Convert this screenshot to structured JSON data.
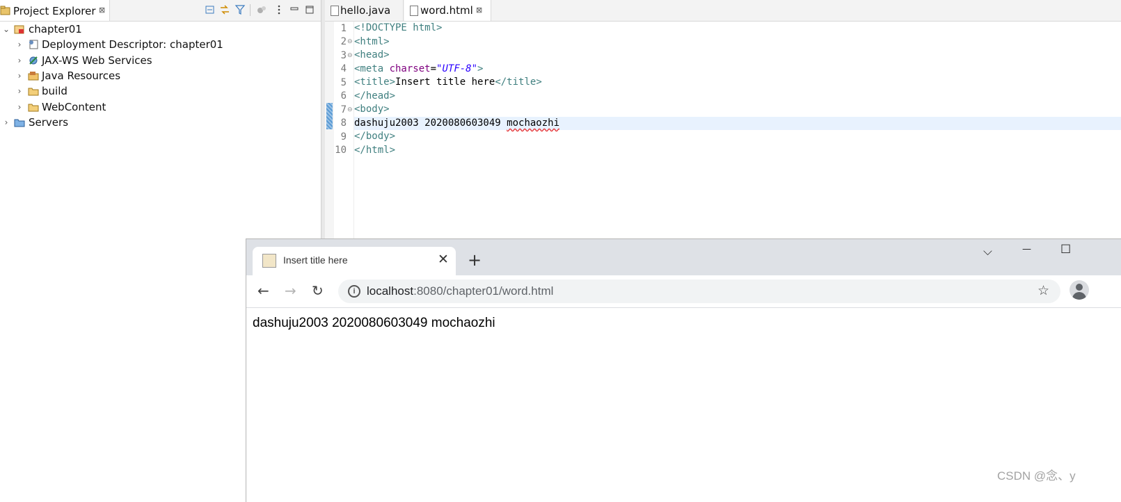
{
  "project_explorer": {
    "title": "Project Explorer",
    "tab_close": "⊠",
    "toolbar_icons": [
      "collapse-all-icon",
      "link-with-editor-icon",
      "filter-icon",
      "focus-icon",
      "view-menu-icon",
      "minimize-icon",
      "maximize-icon"
    ],
    "tree": [
      {
        "label": "chapter01",
        "chevron": "⌄",
        "icon": "web-project-icon"
      },
      {
        "label": "Deployment Descriptor: chapter01",
        "chevron": "›",
        "icon": "deployment-descriptor-icon"
      },
      {
        "label": "JAX-WS Web Services",
        "chevron": "›",
        "icon": "web-services-icon"
      },
      {
        "label": "Java Resources",
        "chevron": "›",
        "icon": "java-resources-icon"
      },
      {
        "label": "build",
        "chevron": "›",
        "icon": "folder-icon"
      },
      {
        "label": "WebContent",
        "chevron": "›",
        "icon": "folder-icon"
      },
      {
        "label": "Servers",
        "chevron": "›",
        "icon": "servers-folder-icon"
      }
    ]
  },
  "editor": {
    "tabs": [
      {
        "label": "hello.java"
      },
      {
        "label": "word.html",
        "close": "⊠",
        "active": true
      }
    ],
    "line_numbers": [
      "1",
      "2",
      "3",
      "4",
      "5",
      "6",
      "7",
      "8",
      "9",
      "10"
    ],
    "fold_markers": {
      "l2": "⊖",
      "l3": "⊖",
      "l7": "⊖"
    },
    "lines": {
      "l1": "<!DOCTYPE html>",
      "l2": "<html>",
      "l3": "<head>",
      "l4_open": "<meta ",
      "l4_attr": "charset",
      "l4_eq": "=",
      "l4_val": "\"UTF-8\"",
      "l4_close": ">",
      "l5_open": "<title>",
      "l5_text": "Insert title here",
      "l5_close": "</title>",
      "l6": "</head>",
      "l7": "<body>",
      "l8_text": "dashuju2003 2020080603049 ",
      "l8_word": "mochaozhi",
      "l9": "</body>",
      "l10": "</html>"
    }
  },
  "browser": {
    "tab_title": "Insert title here",
    "tab_close": "✕",
    "new_tab": "+",
    "window_controls": {
      "tab_search": "⌵",
      "minimize": "—",
      "maximize": "☐"
    },
    "nav": {
      "back": "←",
      "forward": "→",
      "reload": "↻"
    },
    "url_host": "localhost",
    "url_rest": ":8080/chapter01/word.html",
    "info_glyph": "i",
    "star": "☆",
    "page_text": "dashuju2003 2020080603049 mochaozhi"
  },
  "watermark": "CSDN @念、y"
}
